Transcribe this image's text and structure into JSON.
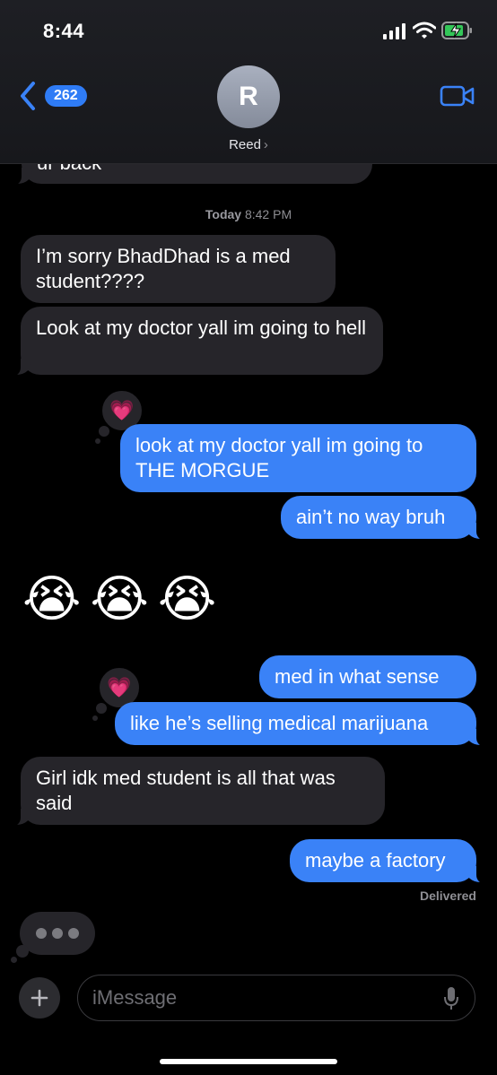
{
  "status_bar": {
    "time": "8:44"
  },
  "header": {
    "back_count": "262",
    "avatar_initial": "R",
    "contact_name": "Reed",
    "chevron": "›"
  },
  "timestamp": {
    "day": "Today",
    "time": "8:42 PM"
  },
  "messages": [
    {
      "id": "m0",
      "dir": "in",
      "text": "ur back"
    },
    {
      "id": "m1",
      "dir": "in",
      "text": "I’m sorry BhadDhad is a med student????"
    },
    {
      "id": "m2",
      "dir": "in",
      "text": "Look at my doctor yall im going to hell"
    },
    {
      "id": "m3",
      "dir": "out",
      "text": "look at my doctor yall im going to THE MORGUE",
      "tapback": "💗"
    },
    {
      "id": "m4",
      "dir": "out",
      "text": "ain’t no way bruh"
    },
    {
      "id": "m5",
      "dir": "in",
      "text": "😭😭😭",
      "emojis": [
        "😭",
        "😭",
        "😭"
      ]
    },
    {
      "id": "m6",
      "dir": "out",
      "text": "med in what sense"
    },
    {
      "id": "m7",
      "dir": "out",
      "text": "like he’s selling medical marijuana",
      "tapback": "💗"
    },
    {
      "id": "m8",
      "dir": "in",
      "text": "Girl idk med student is all that was said"
    },
    {
      "id": "m9",
      "dir": "out",
      "text": "maybe a factory"
    }
  ],
  "delivered_label": "Delivered",
  "input": {
    "placeholder": "iMessage"
  },
  "colors": {
    "outgoing": "#3a82f7",
    "incoming": "#26252a",
    "badge": "#2f7cf6"
  },
  "icons": [
    "back-chevron-icon",
    "facetime-video-icon",
    "plus-icon",
    "microphone-icon",
    "signal-icon",
    "wifi-icon",
    "battery-charging-icon",
    "heart-tapback-icon"
  ]
}
